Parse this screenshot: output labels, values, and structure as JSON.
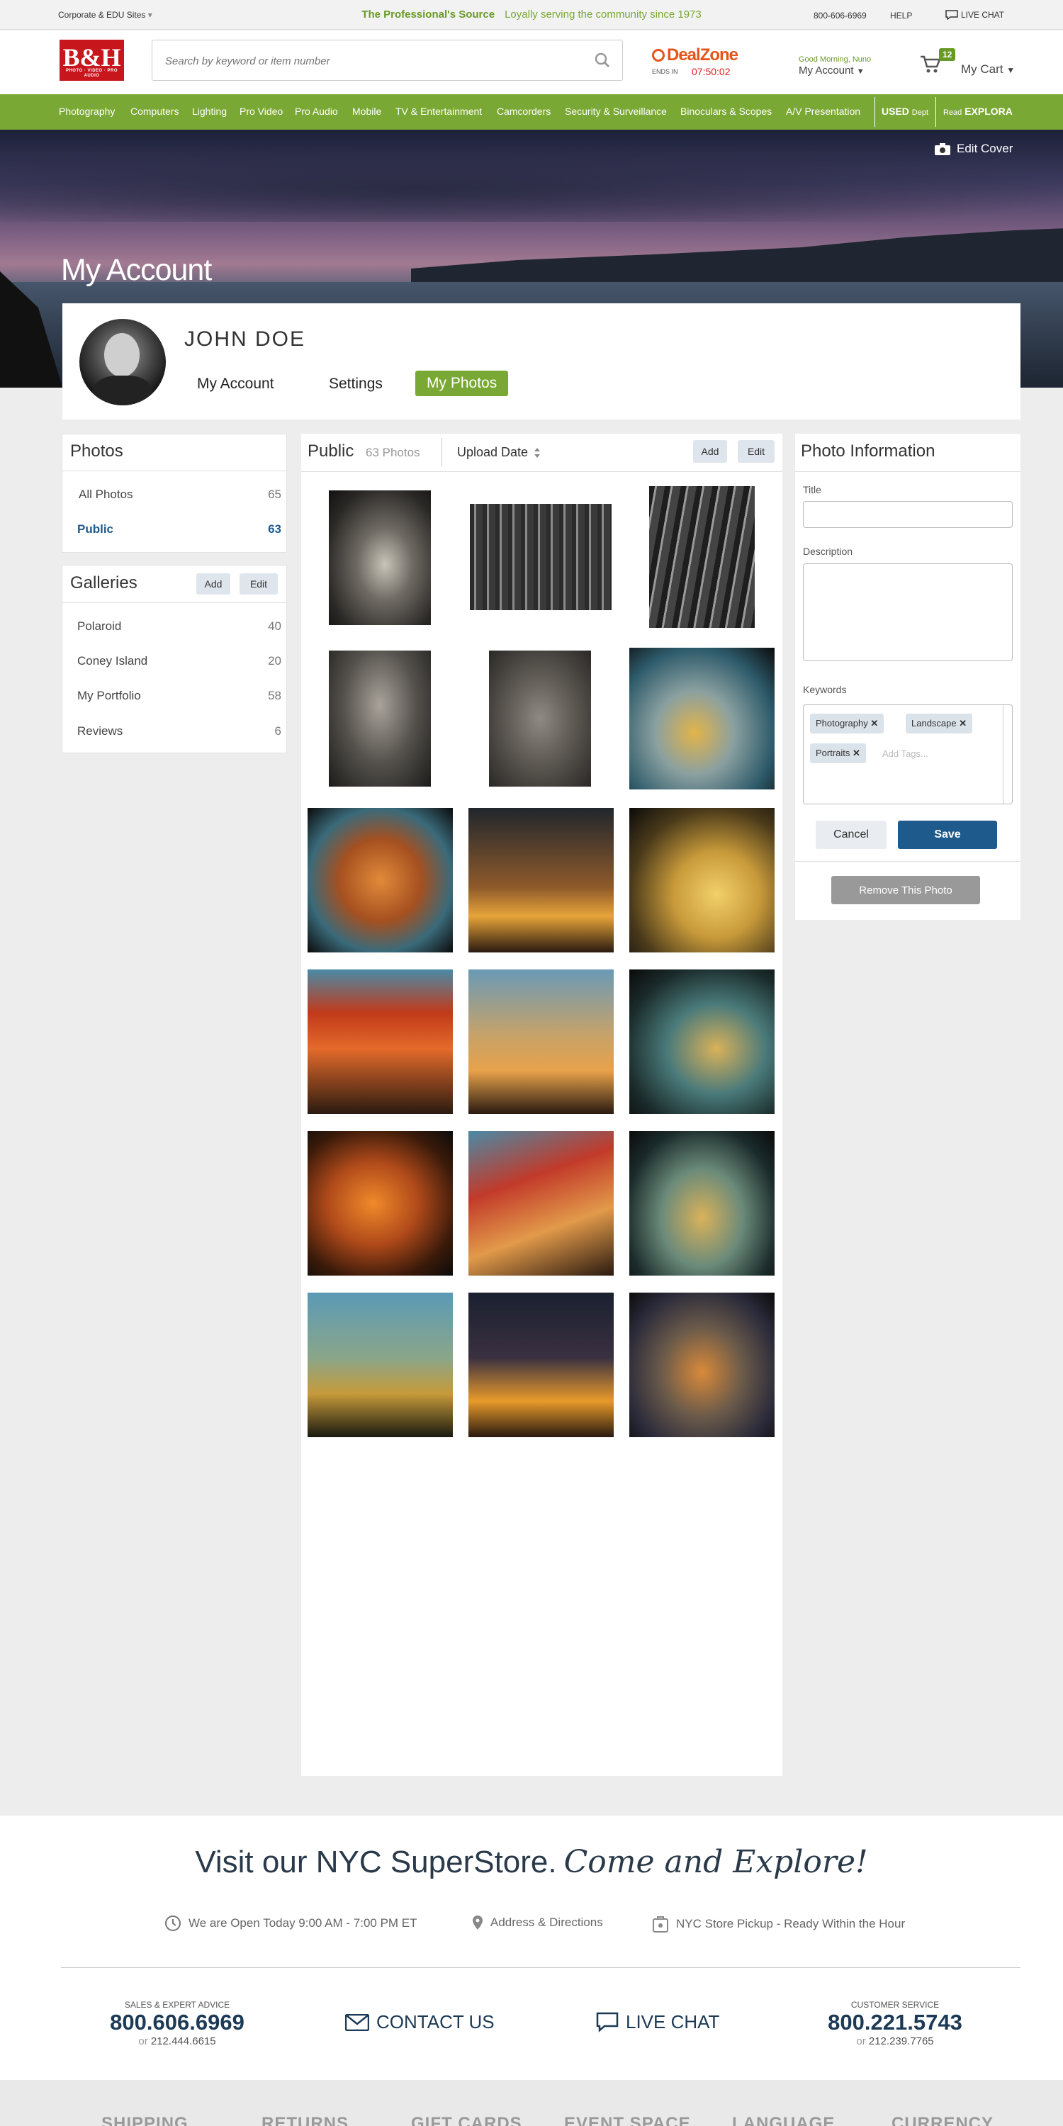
{
  "topbar": {
    "corp_sites": "Corporate & EDU Sites",
    "tagline_bold": "The Professional's Source",
    "tagline": "Loyally serving the community since 1973",
    "phone": "800-606-6969",
    "help": "HELP",
    "live_chat": "LIVE CHAT"
  },
  "header": {
    "logo": "B&H",
    "logo_sub": "PHOTO · VIDEO · PRO AUDIO",
    "search_placeholder": "Search by keyword or item number",
    "deal_zone": "DealZone",
    "ends_in": "ENDS IN",
    "timer": "07:50:02",
    "greeting": "Good Morning, Nuno",
    "my_account": "My Account",
    "cart_count": "12",
    "cart_label": "My Cart"
  },
  "nav": {
    "items": [
      "Photography",
      "Computers",
      "Lighting",
      "Pro Video",
      "Pro Audio",
      "Mobile",
      "TV & Entertainment",
      "Camcorders",
      "Security & Surveillance",
      "Binoculars & Scopes",
      "A/V Presentation"
    ],
    "used": "USED",
    "used_dept": "Dept",
    "read": "Read",
    "explora": "EXPLORA"
  },
  "hero": {
    "edit_cover": "Edit Cover",
    "title": "My Account"
  },
  "profile": {
    "name": "JOHN DOE",
    "tabs": [
      "My Account",
      "Settings",
      "My Photos"
    ]
  },
  "photos_panel": {
    "title": "Photos",
    "rows": [
      {
        "label": "All Photos",
        "count": "65"
      },
      {
        "label": "Public",
        "count": "63"
      }
    ]
  },
  "galleries_panel": {
    "title": "Galleries",
    "add": "Add",
    "edit": "Edit",
    "rows": [
      {
        "label": "Polaroid",
        "count": "40"
      },
      {
        "label": "Coney Island",
        "count": "20"
      },
      {
        "label": "My Portfolio",
        "count": "58"
      },
      {
        "label": "Reviews",
        "count": "6"
      }
    ]
  },
  "grid": {
    "title": "Public",
    "count": "63 Photos",
    "sort": "Upload Date",
    "add": "Add",
    "edit": "Edit"
  },
  "photo_info": {
    "title": "Photo Information",
    "title_label": "Title",
    "title_value": "",
    "description_label": "Description",
    "description_value": "",
    "keywords_label": "Keywords",
    "keywords": [
      "Photography",
      "Landscape",
      "Portraits"
    ],
    "add_tags_placeholder": "Add Tags...",
    "cancel": "Cancel",
    "save": "Save",
    "remove": "Remove This Photo"
  },
  "footer": {
    "visit": "Visit our NYC SuperStore.",
    "visit_script": "Come and Explore!",
    "hours": "We are Open Today 9:00 AM - 7:00 PM ET",
    "address": "Address & Directions",
    "pickup": "NYC Store Pickup - Ready Within the Hour",
    "sales_label": "SALES & EXPERT ADVICE",
    "sales_phone": "800.606.6969",
    "sales_alt": "212.444.6615",
    "contact": "CONTACT US",
    "live_chat": "LIVE CHAT",
    "cs_label": "CUSTOMER SERVICE",
    "cs_phone": "800.221.5743",
    "cs_alt": "212.239.7765",
    "or": "or",
    "bottom_nav": [
      "SHIPPING",
      "RETURNS",
      "GIFT CARDS",
      "EVENT SPACE",
      "LANGUAGE",
      "CURRENCY"
    ]
  },
  "colors": {
    "brand_green": "#7aa834",
    "brand_red": "#c8161d",
    "save_blue": "#1f5a8c",
    "link_blue": "#1f5a8c"
  }
}
